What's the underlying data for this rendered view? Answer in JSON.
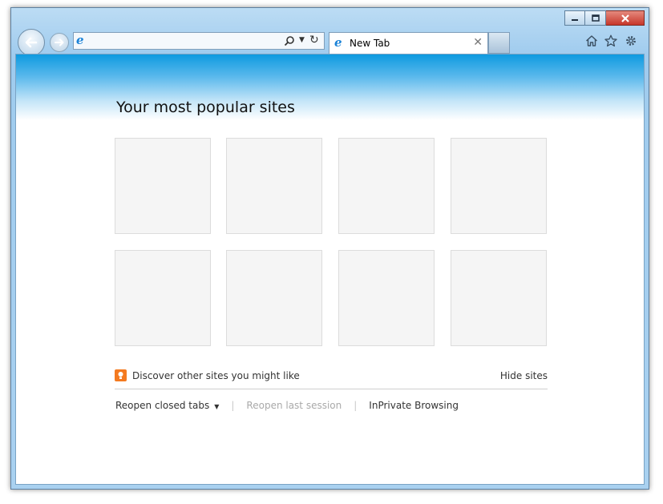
{
  "window": {
    "controls": {
      "minimize": "minimize-icon",
      "maximize": "maximize-icon",
      "close": "close-icon"
    }
  },
  "navigation": {
    "back": "back-arrow-icon",
    "forward": "forward-arrow-icon"
  },
  "address_bar": {
    "value": "",
    "placeholder": "",
    "search_icon": "search-icon",
    "dropdown_icon": "chevron-down-icon",
    "refresh_icon": "refresh-icon"
  },
  "tabs": [
    {
      "label": "New Tab",
      "active": true,
      "close_icon": "close-icon"
    }
  ],
  "toolbar": {
    "home": "home-icon",
    "favorites": "star-icon",
    "tools": "gear-icon"
  },
  "page": {
    "heading": "Your most popular sites",
    "tile_rows": 2,
    "tile_cols": 4,
    "discover_text": "Discover other sites you might like",
    "hide_sites": "Hide sites",
    "reopen_closed_tabs": "Reopen closed tabs",
    "reopen_last_session": "Reopen last session",
    "inprivate_browsing": "InPrivate Browsing"
  },
  "colors": {
    "accent_blue": "#0e9ae0",
    "frame_blue": "#a9d1f0",
    "discover_orange": "#f47a20",
    "close_red": "#c7372b",
    "disabled_text": "#a9a9a9"
  }
}
